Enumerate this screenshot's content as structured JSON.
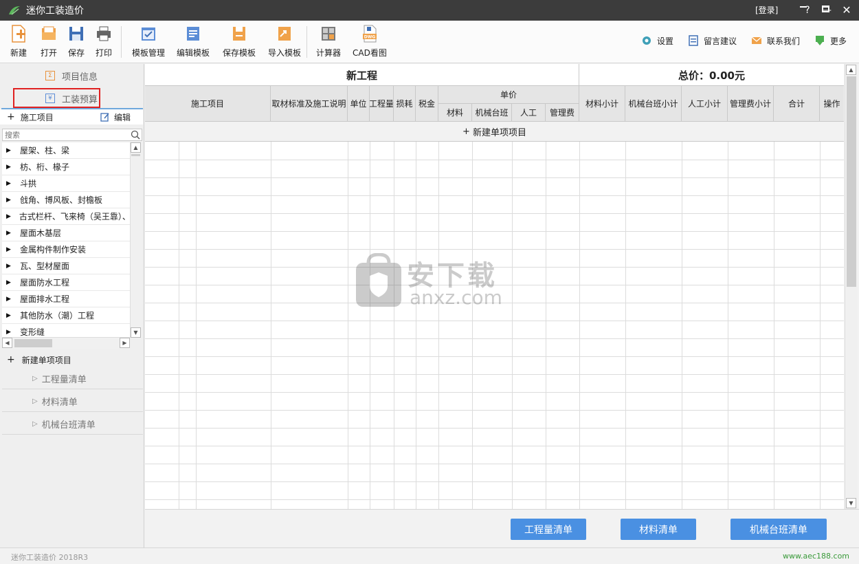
{
  "app": {
    "title": "迷你工装造价",
    "login": "[登录]",
    "version": "迷你工装造价 2018R3",
    "website": "www.aec188.com"
  },
  "window_controls": {
    "help": "?",
    "minimize": "—",
    "maximize": "□",
    "close": "✕"
  },
  "toolbar": {
    "left": [
      {
        "label": "新建",
        "icon": "new-file-icon"
      },
      {
        "label": "打开",
        "icon": "open-folder-icon"
      },
      {
        "label": "保存",
        "icon": "save-disk-icon"
      },
      {
        "label": "打印",
        "icon": "printer-icon"
      },
      {
        "label": "模板管理",
        "icon": "template-manage-icon"
      },
      {
        "label": "编辑模板",
        "icon": "edit-template-icon"
      },
      {
        "label": "保存模板",
        "icon": "save-template-icon"
      },
      {
        "label": "导入模板",
        "icon": "import-template-icon"
      },
      {
        "label": "计算器",
        "icon": "calculator-icon"
      },
      {
        "label": "CAD看图",
        "icon": "dwg-icon"
      }
    ],
    "right": [
      {
        "label": "设置",
        "icon": "gear-icon"
      },
      {
        "label": "留言建议",
        "icon": "note-icon"
      },
      {
        "label": "联系我们",
        "icon": "mail-icon"
      },
      {
        "label": "更多",
        "icon": "more-icon"
      }
    ]
  },
  "sidebar": {
    "tab_info": "项目信息",
    "tab_budget": "工装预算",
    "sub_add": "施工项目",
    "sub_edit": "编辑",
    "search_placeholder": "搜索",
    "tree": [
      "屋架、柱、梁",
      "枋、桁、椽子",
      "斗拱",
      "戗角、博风板、封檐板",
      "古式栏杆、飞来椅（吴王靠）、",
      "屋面木基层",
      "金属构件制作安装",
      "瓦、型材屋面",
      "屋面防水工程",
      "屋面排水工程",
      "其他防水（潮）工程",
      "变形缝"
    ],
    "new_item": "新建单项项目",
    "lists": [
      "工程量清单",
      "材料清单",
      "机械台班清单"
    ]
  },
  "grid": {
    "project_title": "新工程",
    "total": "总价：0.00元",
    "headers": {
      "item": "施工项目",
      "desc": "取材标准及施工说明",
      "unit": "单位",
      "qty": "工程量",
      "loss": "损耗",
      "tax": "税金",
      "unit_price": "单价",
      "material": "材料",
      "machine": "机械台班",
      "labor": "人工",
      "mgmt": "管理费",
      "material_sub": "材料小计",
      "machine_sub": "机械台班小计",
      "labor_sub": "人工小计",
      "mgmt_sub": "管理费小计",
      "sum": "合计",
      "op": "操作"
    },
    "new_row": "新建单项项目"
  },
  "watermark": {
    "cn": "安下载",
    "en": "anxz.com"
  },
  "bottom_buttons": [
    "工程量清单",
    "材料清单",
    "机械台班清单"
  ],
  "colors": {
    "titlebar": "#3c3c3c",
    "accent_blue": "#4a90e2",
    "highlight_red": "#e02020",
    "site_green": "#3a9a3a"
  }
}
